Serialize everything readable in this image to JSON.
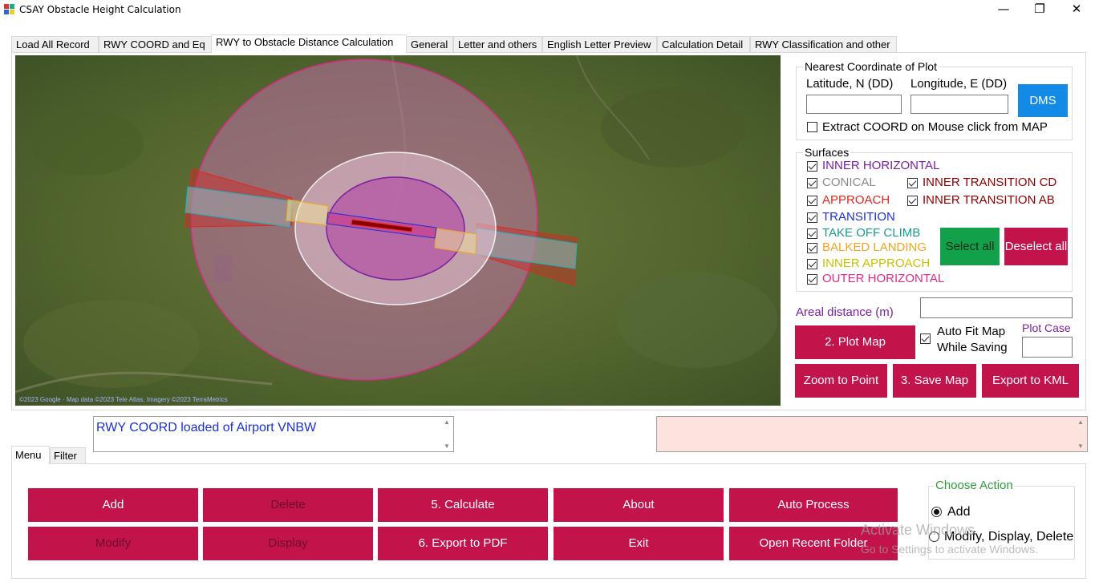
{
  "window": {
    "title": "CSAY Obstacle Height Calculation",
    "minimize": "—",
    "restore": "❐",
    "close": "✕"
  },
  "tabs": [
    {
      "label": "Load All Record"
    },
    {
      "label": "RWY COORD and Eq"
    },
    {
      "label": "RWY to Obstacle Distance Calculation",
      "active": true
    },
    {
      "label": "General"
    },
    {
      "label": "Letter and others"
    },
    {
      "label": "English Letter Preview"
    },
    {
      "label": "Calculation Detail"
    },
    {
      "label": "RWY Classification and other"
    }
  ],
  "map": {
    "attribution": "©2023 Google · Map data ©2023 Tele Atlas, Imagery ©2023 TerraMetrics"
  },
  "nearest": {
    "title": "Nearest Coordinate of Plot",
    "lat_label": "Latitude, N (DD)",
    "lon_label": "Longitude, E (DD)",
    "lat_value": "",
    "lon_value": "",
    "dms_button": "DMS",
    "extract_label": "Extract COORD on Mouse click from MAP",
    "extract_checked": false
  },
  "surfaces": {
    "title": "Surfaces",
    "items": [
      {
        "label": "INNER HORIZONTAL",
        "color": "#7b1fa2",
        "checked": true
      },
      {
        "label": "CONICAL",
        "color": "#8a8a8a",
        "checked": true
      },
      {
        "label": "INNER TRANSITION CD",
        "color": "#8b0000",
        "checked": true
      },
      {
        "label": "APPROACH",
        "color": "#e0281c",
        "checked": true
      },
      {
        "label": "INNER TRANSITION AB",
        "color": "#8b0000",
        "checked": true
      },
      {
        "label": "TRANSITION",
        "color": "#1a2fd6",
        "checked": true
      },
      {
        "label": "TAKE OFF CLIMB",
        "color": "#1a9a8e",
        "checked": true
      },
      {
        "label": "BALKED LANDING",
        "color": "#f2a51c",
        "checked": true
      },
      {
        "label": "INNER APPROACH",
        "color": "#c8c200",
        "checked": true
      },
      {
        "label": "OUTER HORIZONTAL",
        "color": "#e0288a",
        "checked": true
      }
    ],
    "select_all": "Select all",
    "deselect_all": "Deselect all"
  },
  "areal": {
    "label": "Areal distance (m)",
    "value": ""
  },
  "plot": {
    "plot_map": "2. Plot Map",
    "auto_fit_label": "Auto Fit Map While Saving",
    "auto_fit_checked": true,
    "plot_case_label": "Plot Case",
    "plot_case_value": "",
    "zoom_to_point": "Zoom to Point",
    "save_map": "3. Save Map",
    "export_kml": "Export to KML"
  },
  "log": {
    "message": "RWY COORD loaded of Airport VNBW"
  },
  "bottom_tabs": [
    {
      "label": "Menu",
      "active": true
    },
    {
      "label": "Filter"
    }
  ],
  "actions": {
    "add": "Add",
    "delete": "Delete",
    "calculate": "5. Calculate",
    "about": "About",
    "auto_process": "Auto Process",
    "modify": "Modify",
    "display": "Display",
    "export_pdf": "6. Export to PDF",
    "exit": "Exit",
    "open_recent": "Open Recent Folder"
  },
  "choose_action": {
    "title": "Choose Action",
    "options": [
      {
        "label": "Add",
        "selected": true
      },
      {
        "label": "Modify, Display, Delete",
        "selected": false
      }
    ]
  },
  "watermark": {
    "line1": "Activate Windows",
    "line2": "Go to Settings to activate Windows."
  },
  "colors": {
    "accent": "#c2134b",
    "green": "#12a04a",
    "blue": "#138ae6",
    "group_title_green": "#2e9b3a",
    "purple_label": "#7b1fa2"
  }
}
